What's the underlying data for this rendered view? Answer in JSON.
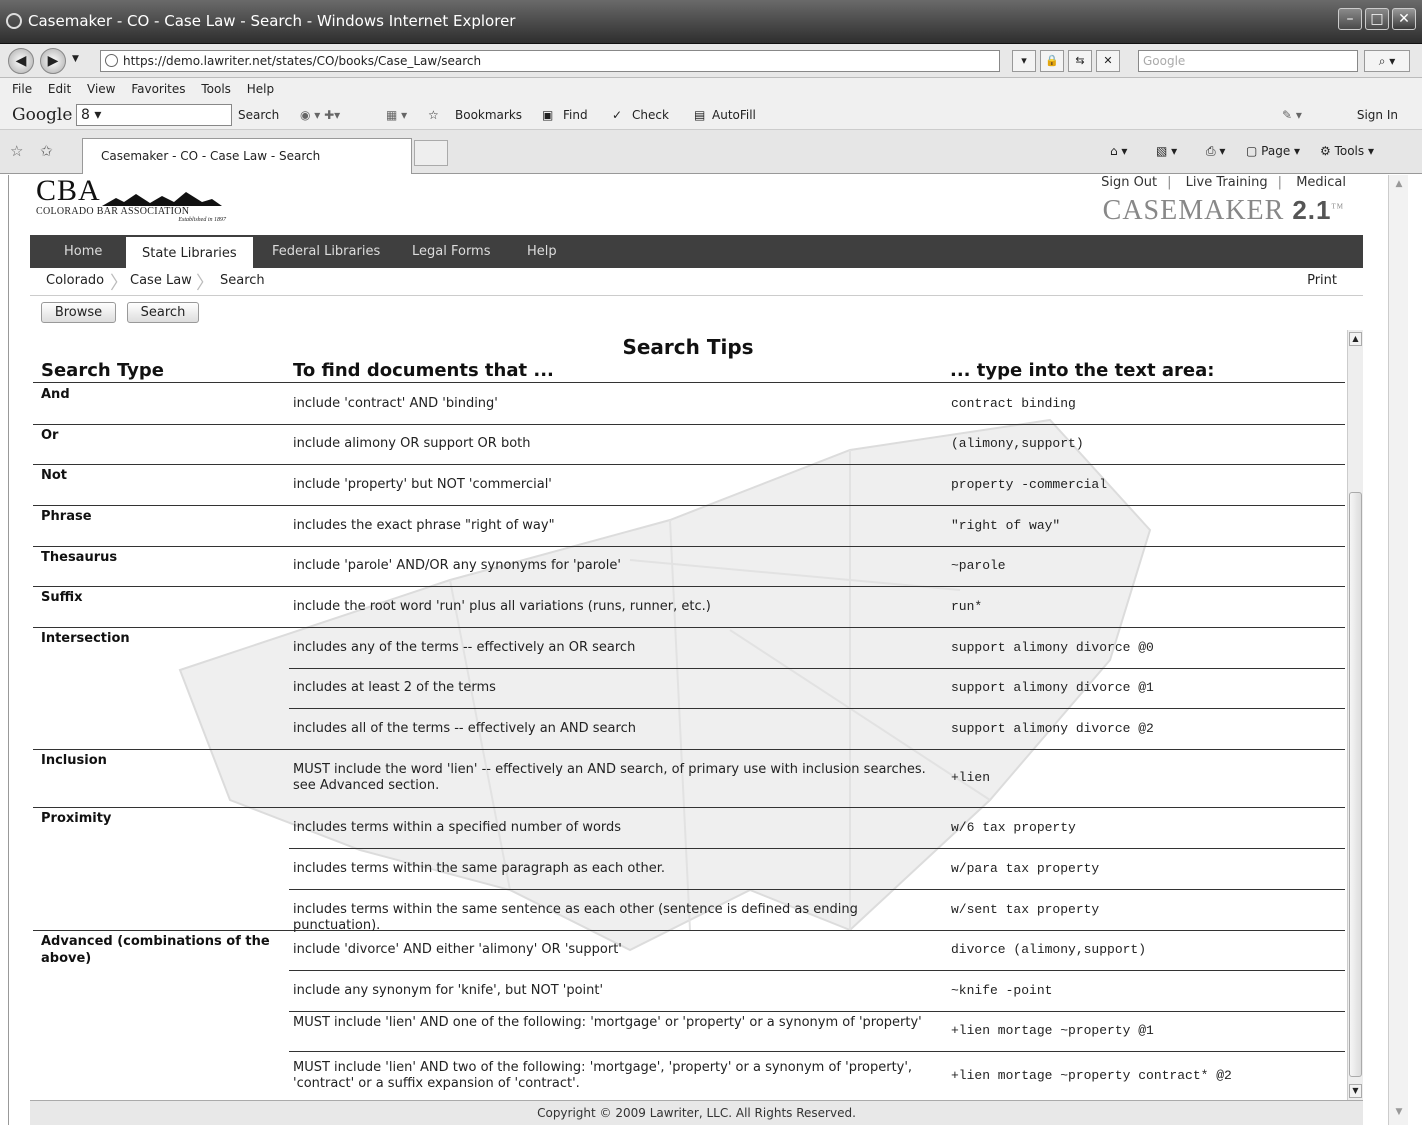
{
  "window": {
    "title": "Casemaker - CO - Case Law - Search - Windows Internet Explorer"
  },
  "address": {
    "url": "https://demo.lawriter.net/states/CO/books/Case_Law/search",
    "search_placeholder": "Google"
  },
  "menu": [
    "File",
    "Edit",
    "View",
    "Favorites",
    "Tools",
    "Help"
  ],
  "google_toolbar": {
    "logo": "Google",
    "box_value": "8 ▾",
    "search": "Search",
    "bookmarks": "Bookmarks",
    "find": "Find",
    "check": "Check",
    "autofill": "AutoFill",
    "sign_in": "Sign In"
  },
  "tab": {
    "label": "Casemaker - CO - Case Law - Search"
  },
  "command_bar": {
    "page": "Page",
    "tools": "Tools"
  },
  "site": {
    "logo_text": "CBA",
    "org": "COLORADO BAR ASSOCIATION",
    "established": "Established in 1897",
    "top_links": [
      "Sign Out",
      "Live Training",
      "Medical"
    ],
    "brand": "CASEMAKER",
    "brand_version": "2.1",
    "brand_tm": "TM",
    "nav": [
      "Home",
      "State Libraries",
      "Federal Libraries",
      "Legal Forms",
      "Help"
    ],
    "breadcrumbs": [
      "Colorado",
      "Case Law",
      "Search"
    ],
    "print": "Print",
    "buttons": {
      "browse": "Browse",
      "search": "Search"
    }
  },
  "tips": {
    "title": "Search Tips",
    "headers": [
      "Search Type",
      "To find documents that ...",
      "... type into the text area:"
    ],
    "rows": [
      {
        "type": "And",
        "desc": "include 'contract' AND 'binding'",
        "code": "contract binding"
      },
      {
        "type": "Or",
        "desc": "include alimony OR support OR both",
        "code": "(alimony,support)"
      },
      {
        "type": "Not",
        "desc": "include 'property' but NOT 'commercial'",
        "code": "property -commercial"
      },
      {
        "type": "Phrase",
        "desc": "includes the exact phrase \"right of way\"",
        "code": "\"right of way\""
      },
      {
        "type": "Thesaurus",
        "desc": "include 'parole' AND/OR any synonyms for 'parole'",
        "code": "~parole"
      },
      {
        "type": "Suffix",
        "desc": "include the root word 'run' plus all variations (runs, runner, etc.)",
        "code": "run*"
      },
      {
        "type": "Intersection",
        "desc": "includes any of the terms -- effectively an OR search",
        "code": "support alimony divorce @0"
      },
      {
        "type": "",
        "desc": "includes at least 2 of the terms",
        "code": "support alimony divorce @1"
      },
      {
        "type": "",
        "desc": "includes all of the terms -- effectively an AND search",
        "code": "support alimony divorce @2"
      },
      {
        "type": "Inclusion",
        "desc": "MUST include the word 'lien' -- effectively an AND search, of primary use with inclusion searches. see Advanced section.",
        "code": "+lien"
      },
      {
        "type": "Proximity",
        "desc": "includes terms within a specified number of words",
        "code": "w/6 tax property"
      },
      {
        "type": "",
        "desc": "includes terms within the same paragraph as each other.",
        "code": "w/para tax property"
      },
      {
        "type": "",
        "desc": "includes terms within the same sentence as each other (sentence is defined as ending punctuation).",
        "code": "w/sent tax property"
      },
      {
        "type": "Advanced (combinations of the above)",
        "desc": "include 'divorce' AND either 'alimony' OR 'support'",
        "code": "divorce (alimony,support)"
      },
      {
        "type": "",
        "desc": "include any synonym for 'knife', but NOT 'point'",
        "code": "~knife -point"
      },
      {
        "type": "",
        "desc": "MUST include 'lien' AND one of the following: 'mortgage' or 'property' or a synonym of 'property'",
        "code": "+lien mortage ~property @1"
      },
      {
        "type": "",
        "desc": "MUST include 'lien' AND two of the following: 'mortgage', 'property' or a synonym of 'property', 'contract' or a suffix expansion of 'contract'.",
        "code": "+lien mortage ~property contract* @2"
      }
    ]
  },
  "footer": "Copyright © 2009 Lawriter, LLC. All Rights Reserved."
}
